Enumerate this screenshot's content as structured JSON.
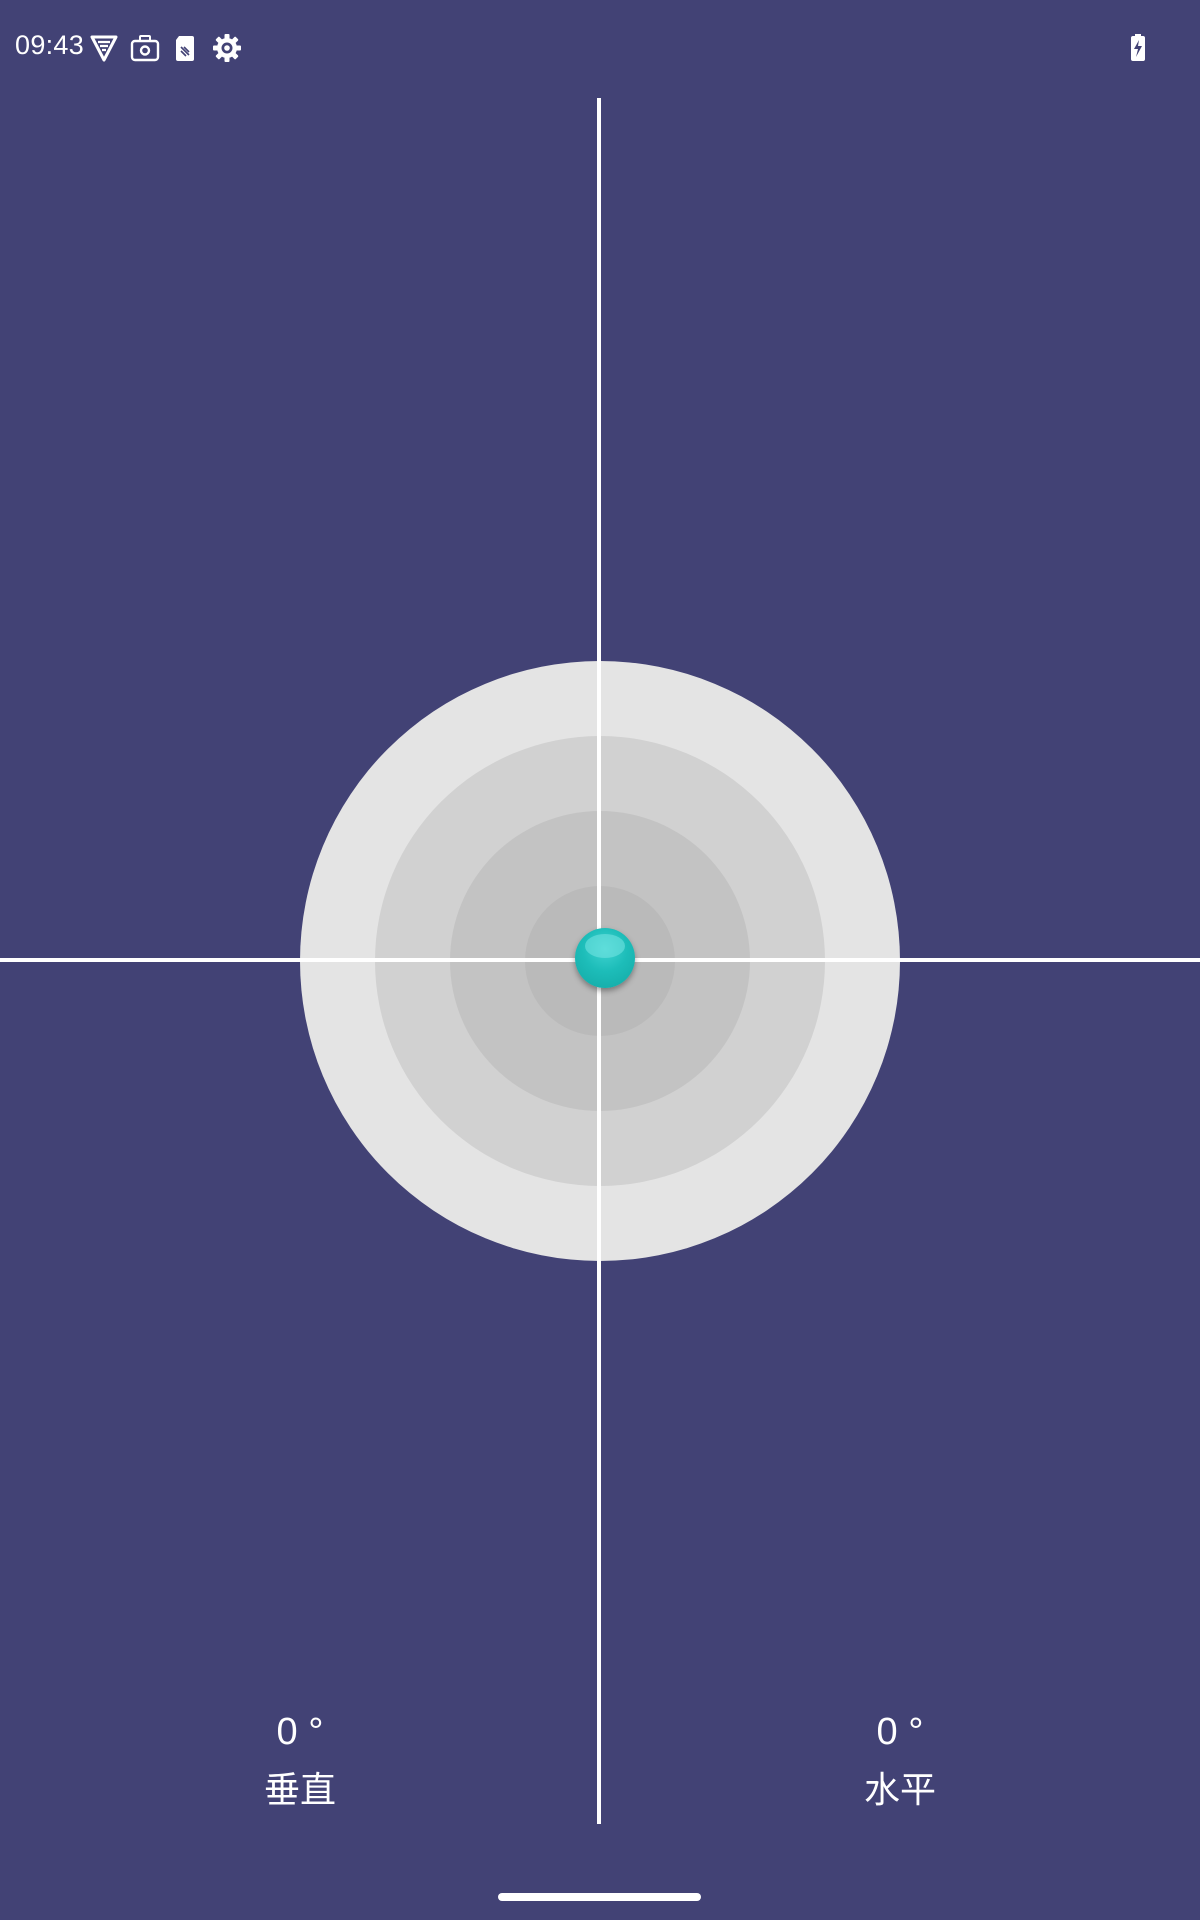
{
  "status_bar": {
    "time": "09:43",
    "icons": [
      "vpn-shield-icon",
      "camera-settings-icon",
      "sim-card-icon",
      "settings-gear-icon",
      "battery-charging-icon"
    ]
  },
  "level": {
    "vertical": {
      "value": "0 °",
      "label": "垂直"
    },
    "horizontal": {
      "value": "0 °",
      "label": "水平"
    }
  },
  "colors": {
    "background": "#424275",
    "bubble": "#1dbdb9",
    "ring_outer": "#e4e4e4",
    "ring_inner": "#bababa"
  }
}
